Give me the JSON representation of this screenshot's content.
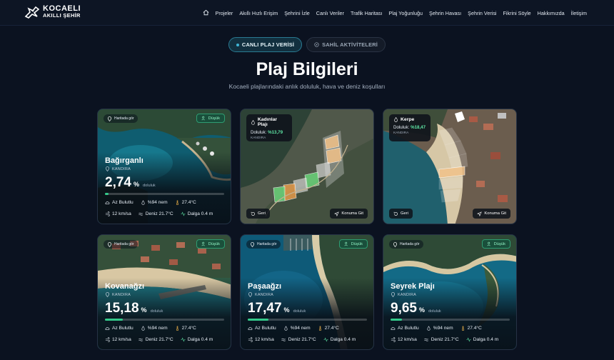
{
  "brand": {
    "line1": "KOCAELI",
    "line2": "AKILLI ŞEHİR"
  },
  "nav": {
    "home_icon": "home-icon",
    "items": [
      "Projeler",
      "Akıllı Hızlı Erişim",
      "Şehrini İzle",
      "Canlı Veriler",
      "Trafik Haritası",
      "Plaj Yoğunluğu",
      "Şehrin Havası",
      "Şehrin Verisi",
      "Fikrini Söyle",
      "Hakkımızda",
      "İletişim"
    ]
  },
  "tabs": [
    {
      "label": "CANLI PLAJ VERİSİ",
      "active": true
    },
    {
      "label": "SAHİL AKTİVİTELERİ",
      "active": false
    }
  ],
  "page": {
    "title": "Plaj Bilgileri",
    "subtitle": "Kocaeli plajlarındaki anlık doluluk, hava ve deniz koşulları"
  },
  "common": {
    "map_link": "Haritada gör",
    "occupancy_label": "doluluk",
    "percent": "%",
    "back": "Geri",
    "go": "Konuma Git",
    "fill_prefix": "Doluluk: "
  },
  "cards": [
    {
      "name": "Bağırganlı",
      "district": "KANDIRA",
      "status": "Düşük",
      "occupancy": "2,74",
      "occupancy_value": 2.74,
      "weather": "Az Bulutlu",
      "humidity": "%94 nem",
      "temp": "27.4°C",
      "wind": "12 km/sa",
      "sea": "Deniz 21.7°C",
      "wave": "Dalga 0.4 m"
    },
    {
      "name": "Kadınlar Plajı",
      "district": "KANDIRA",
      "fill": "%13,79",
      "occupancy_value": 13.79
    },
    {
      "name": "Kerpe",
      "district": "KANDIRA",
      "fill": "%18,47",
      "occupancy_value": 18.47
    },
    {
      "name": "Kovanağzı",
      "district": "KANDIRA",
      "status": "Düşük",
      "occupancy": "15,18",
      "occupancy_value": 15.18,
      "weather": "Az Bulutlu",
      "humidity": "%94 nem",
      "temp": "27.4°C",
      "wind": "12 km/sa",
      "sea": "Deniz 21.7°C",
      "wave": "Dalga 0.4 m"
    },
    {
      "name": "Paşaağzı",
      "district": "KANDIRA",
      "status": "Düşük",
      "occupancy": "17,47",
      "occupancy_value": 17.47,
      "weather": "Az Bulutlu",
      "humidity": "%94 nem",
      "temp": "27.4°C",
      "wind": "12 km/sa",
      "sea": "Deniz 21.7°C",
      "wave": "Dalga 0.4 m"
    },
    {
      "name": "Seyrek Plajı",
      "district": "KANDIRA",
      "status": "Düşük",
      "occupancy": "9,65",
      "occupancy_value": 9.65,
      "weather": "Az Bulutlu",
      "humidity": "%94 nem",
      "temp": "27.4°C",
      "wind": "12 km/sa",
      "sea": "Deniz 21.7°C",
      "wave": "Dalga 0.4 m"
    }
  ],
  "colors": {
    "accent": "#34c98a",
    "background": "#0b1220",
    "tab_active": "#2a7a92"
  }
}
